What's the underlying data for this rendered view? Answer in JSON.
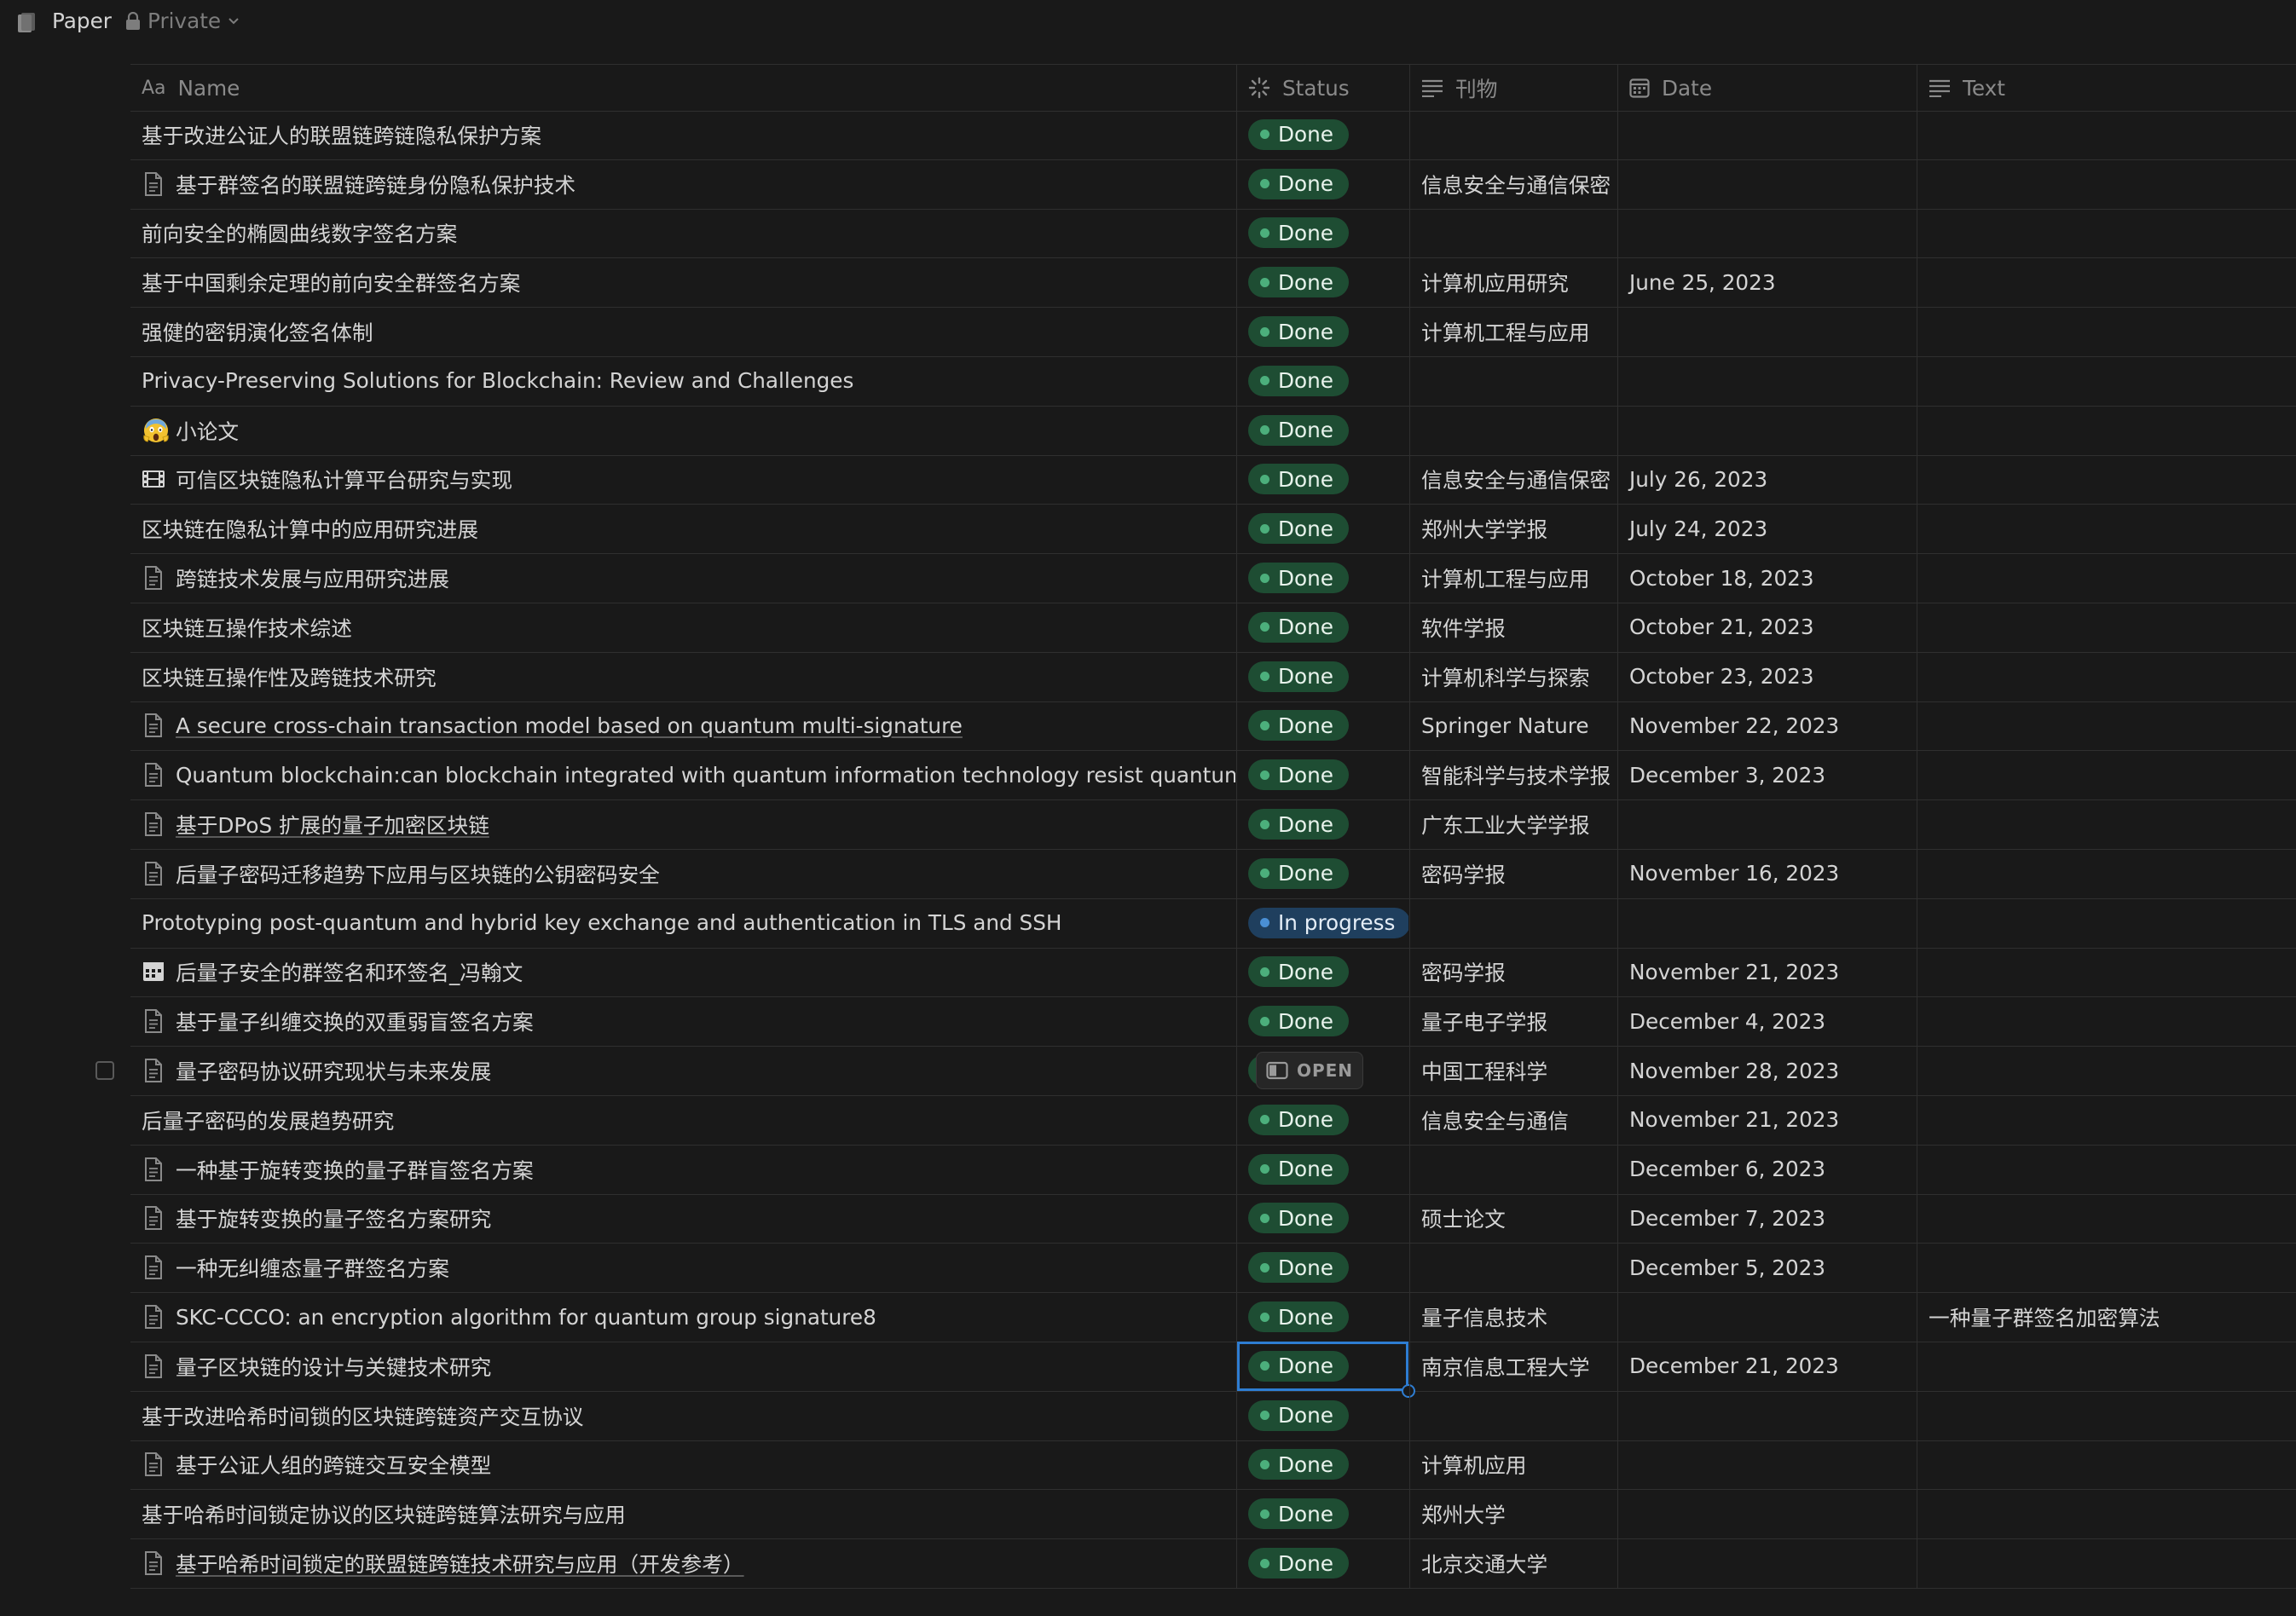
{
  "topbar": {
    "title": "Paper",
    "privacy": "Private"
  },
  "columns": {
    "name": {
      "label": "Name",
      "icon_text": "Aa"
    },
    "status": {
      "label": "Status",
      "icon": "status-icon"
    },
    "publication": {
      "label": "刊物",
      "icon": "text-lines-icon"
    },
    "date": {
      "label": "Date",
      "icon": "calendar-icon"
    },
    "text": {
      "label": "Text",
      "icon": "text-lines-icon"
    }
  },
  "open_button": {
    "label": "OPEN"
  },
  "rows": [
    {
      "name": "基于改进公证人的联盟链跨链隐私保护方案",
      "icon": "none",
      "status": "Done",
      "publication": "",
      "date": "",
      "text": ""
    },
    {
      "name": "基于群签名的联盟链跨链身份隐私保护技术",
      "icon": "page",
      "status": "Done",
      "publication": "信息安全与通信保密",
      "date": "",
      "text": ""
    },
    {
      "name": "前向安全的椭圆曲线数字签名方案",
      "icon": "none",
      "status": "Done",
      "publication": "",
      "date": "",
      "text": ""
    },
    {
      "name": "基于中国剩余定理的前向安全群签名方案",
      "icon": "none",
      "status": "Done",
      "publication": "计算机应用研究",
      "date": "June 25, 2023",
      "text": ""
    },
    {
      "name": "强健的密钥演化签名体制",
      "icon": "none",
      "status": "Done",
      "publication": "计算机工程与应用",
      "date": "",
      "text": ""
    },
    {
      "name": "Privacy-Preserving Solutions for Blockchain: Review and Challenges",
      "icon": "none",
      "status": "Done",
      "publication": "",
      "date": "",
      "text": ""
    },
    {
      "name": "小论文",
      "icon": "emoji-scream",
      "status": "Done",
      "publication": "",
      "date": "",
      "text": ""
    },
    {
      "name": "可信区块链隐私计算平台研究与实现",
      "icon": "film",
      "status": "Done",
      "publication": "信息安全与通信保密",
      "date": "July 26, 2023",
      "text": ""
    },
    {
      "name": "区块链在隐私计算中的应用研究进展",
      "icon": "none",
      "status": "Done",
      "publication": "郑州大学学报",
      "date": "July 24, 2023",
      "text": ""
    },
    {
      "name": "跨链技术发展与应用研究进展",
      "icon": "page",
      "status": "Done",
      "publication": "计算机工程与应用",
      "date": "October 18, 2023",
      "text": ""
    },
    {
      "name": "区块链互操作技术综述",
      "icon": "none",
      "status": "Done",
      "publication": "软件学报",
      "date": "October 21, 2023",
      "text": ""
    },
    {
      "name": "区块链互操作性及跨链技术研究",
      "icon": "none",
      "status": "Done",
      "publication": "计算机科学与探索",
      "date": "October 23, 2023",
      "text": ""
    },
    {
      "name": "A secure cross-chain transaction model based on quantum multi-signature",
      "icon": "page",
      "status": "Done",
      "publication": "Springer Nature",
      "date": "November 22, 2023",
      "text": "",
      "underline": true
    },
    {
      "name": "Quantum blockchain:can blockchain integrated with quantum information technology resist quantum supremacy",
      "icon": "page",
      "status": "Done",
      "publication": "智能科学与技术学报",
      "date": "December 3, 2023",
      "text": ""
    },
    {
      "name": "基于DPoS 扩展的量子加密区块链",
      "icon": "page",
      "status": "Done",
      "publication": "广东工业大学学报",
      "date": "",
      "text": "",
      "underline": true
    },
    {
      "name": "后量子密码迁移趋势下应用与区块链的公钥密码安全",
      "icon": "page",
      "status": "Done",
      "publication": "密码学报",
      "date": "November 16, 2023",
      "text": ""
    },
    {
      "name": "Prototyping post-quantum and hybrid key exchange and authentication in TLS and SSH",
      "icon": "none",
      "status": "In progress",
      "publication": "",
      "date": "",
      "text": ""
    },
    {
      "name": "后量子安全的群签名和环签名_冯翰文",
      "icon": "calendar",
      "status": "Done",
      "publication": "密码学报",
      "date": "November 21, 2023",
      "text": ""
    },
    {
      "name": "基于量子纠缠交换的双重弱盲签名方案",
      "icon": "page",
      "status": "Done",
      "publication": "量子电子学报",
      "date": "December 4, 2023",
      "text": ""
    },
    {
      "name": "量子密码协议研究现状与未来发展",
      "icon": "page",
      "status": "Done",
      "publication": "中国工程科学",
      "date": "November 28, 2023",
      "text": "",
      "hovered": true
    },
    {
      "name": "后量子密码的发展趋势研究",
      "icon": "none",
      "status": "Done",
      "publication": "信息安全与通信",
      "date": "November 21, 2023",
      "text": ""
    },
    {
      "name": "一种基于旋转变换的量子群盲签名方案",
      "icon": "page",
      "status": "Done",
      "publication": "",
      "date": "December 6, 2023",
      "text": ""
    },
    {
      "name": "基于旋转变换的量子签名方案研究",
      "icon": "page",
      "status": "Done",
      "publication": "硕士论文",
      "date": "December 7, 2023",
      "text": ""
    },
    {
      "name": "一种无纠缠态量子群签名方案",
      "icon": "page",
      "status": "Done",
      "publication": "",
      "date": "December 5, 2023",
      "text": ""
    },
    {
      "name": "SKC-CCCO: an encryption algorithm for quantum group signature8",
      "icon": "page",
      "status": "Done",
      "publication": "量子信息技术",
      "date": "",
      "text": "一种量子群签名加密算法"
    },
    {
      "name": "量子区块链的设计与关键技术研究",
      "icon": "page",
      "status": "Done",
      "publication": "南京信息工程大学",
      "date": "December 21, 2023",
      "text": "",
      "selected": true
    },
    {
      "name": "基于改进哈希时间锁的区块链跨链资产交互协议",
      "icon": "none",
      "status": "Done",
      "publication": "",
      "date": "",
      "text": ""
    },
    {
      "name": "基于公证人组的跨链交互安全模型",
      "icon": "page",
      "status": "Done",
      "publication": "计算机应用",
      "date": "",
      "text": ""
    },
    {
      "name": "基于哈希时间锁定协议的区块链跨链算法研究与应用",
      "icon": "none",
      "status": "Done",
      "publication": "郑州大学",
      "date": "",
      "text": ""
    },
    {
      "name": "基于哈希时间锁定的联盟链跨链技术研究与应用（开发参考）",
      "icon": "page",
      "status": "Done",
      "publication": "北京交通大学",
      "date": "",
      "text": "",
      "underline": true
    }
  ]
}
